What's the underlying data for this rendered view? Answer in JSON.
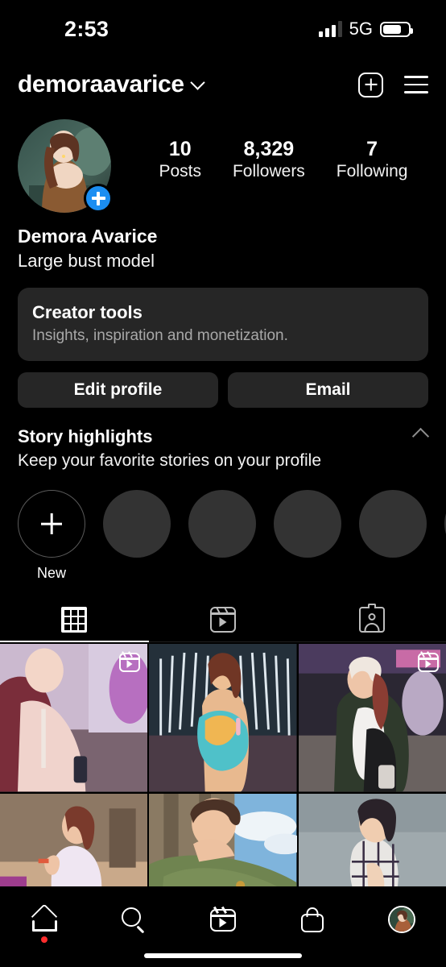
{
  "status_bar": {
    "time": "2:53",
    "network": "5G",
    "signal_icon": "signal-bars-icon",
    "battery_icon": "battery-icon",
    "battery_level_pct": 72
  },
  "header": {
    "username": "demoraavarice",
    "chevron_icon": "chevron-down-icon",
    "create_icon": "plus-square-icon",
    "menu_icon": "hamburger-menu-icon"
  },
  "profile": {
    "avatar_icon": "profile-avatar",
    "add_story_icon": "plus-circle-icon",
    "full_name": "Demora Avarice",
    "bio": "Large bust model",
    "stats": [
      {
        "value": "10",
        "label": "Posts"
      },
      {
        "value": "8,329",
        "label": "Followers"
      },
      {
        "value": "7",
        "label": "Following"
      }
    ]
  },
  "creator_tools": {
    "title": "Creator tools",
    "subtitle": "Insights, inspiration and monetization."
  },
  "actions": [
    {
      "label": "Edit profile"
    },
    {
      "label": "Email"
    }
  ],
  "story_highlights": {
    "title": "Story highlights",
    "subtitle": "Keep your favorite stories on your profile",
    "collapse_icon": "chevron-up-icon",
    "new_label": "New",
    "placeholder_count": 5
  },
  "tabs": [
    {
      "name": "grid",
      "icon": "grid-icon",
      "active": true
    },
    {
      "name": "reels",
      "icon": "reels-icon",
      "active": false
    },
    {
      "name": "tagged",
      "icon": "tagged-person-icon",
      "active": false
    }
  ],
  "post_grid": {
    "columns": 3,
    "cells": [
      {
        "id": 1,
        "is_reel": true,
        "reel_icon": "reels-badge-icon"
      },
      {
        "id": 2,
        "is_reel": false
      },
      {
        "id": 3,
        "is_reel": true,
        "reel_icon": "reels-badge-icon"
      },
      {
        "id": 4,
        "is_reel": false
      },
      {
        "id": 5,
        "is_reel": false
      },
      {
        "id": 6,
        "is_reel": false
      }
    ]
  },
  "bottom_nav": [
    {
      "name": "home",
      "icon": "home-icon",
      "has_badge": true
    },
    {
      "name": "search",
      "icon": "search-icon",
      "has_badge": false
    },
    {
      "name": "reels",
      "icon": "reels-icon",
      "has_badge": false
    },
    {
      "name": "shop",
      "icon": "shopping-bag-icon",
      "has_badge": false
    },
    {
      "name": "profile",
      "icon": "profile-avatar-icon",
      "has_badge": false
    }
  ],
  "colors": {
    "background": "#000000",
    "surface": "#262626",
    "placeholder": "#333333",
    "accent_blue": "#1b8ef2",
    "badge_red": "#ff2d2d",
    "muted_text": "#a8a8a8"
  }
}
